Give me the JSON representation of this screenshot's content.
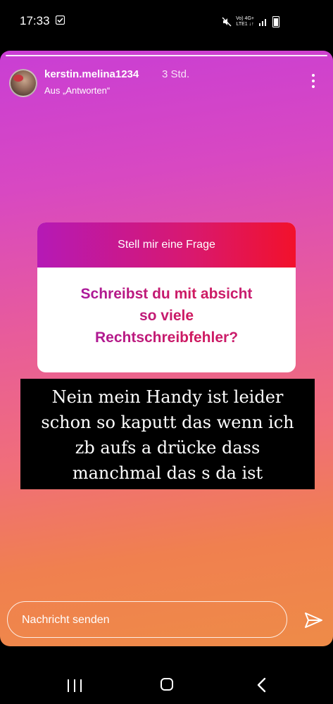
{
  "status_bar": {
    "time": "17:33",
    "network_top": "Vo) 4G+",
    "network_bottom": "LTE1 ↓↑"
  },
  "story": {
    "username": "kerstin.melina1234",
    "time_ago": "3 Std.",
    "subtitle": "Aus „Antworten“",
    "question_sticker": {
      "header": "Stell mir eine Frage",
      "question_lines": [
        "Schreibst du mit absicht",
        "so viele",
        "Rechtschreibfehler?"
      ]
    },
    "answer_lines": [
      "Nein mein Handy ist leider",
      "schon so kaputt das wenn ich",
      "zb aufs a drücke dass",
      "manchmal das s da ist"
    ],
    "reply_placeholder": "Nachricht senden"
  },
  "colors": {
    "sticker_gradient": [
      "#b519b6",
      "#f2112b"
    ],
    "question_text": "#b3147f",
    "background_top": "#c93ed4",
    "background_bottom": "#ee8b48"
  },
  "icons": {
    "more": "more-vertical-icon",
    "send": "paper-plane-icon",
    "nav_recent": "recent-apps-icon",
    "nav_home": "home-icon",
    "nav_back": "back-chevron-icon"
  }
}
